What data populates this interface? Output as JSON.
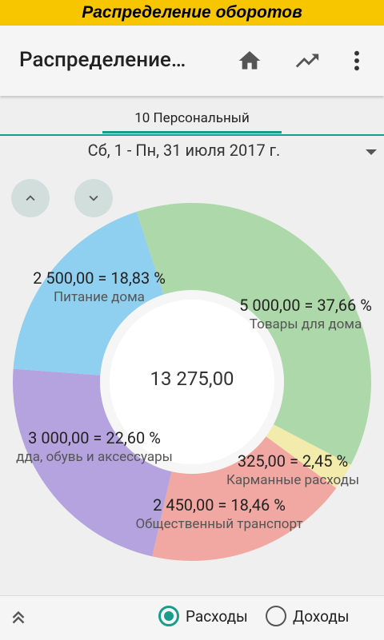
{
  "banner": {
    "text": "Распределение оборотов"
  },
  "appbar": {
    "title": "Распределение…",
    "icons": [
      "home-icon",
      "trending-icon",
      "more-vert-icon"
    ]
  },
  "tabs": [
    {
      "label": "10 Персональный",
      "active": true
    }
  ],
  "period": {
    "label": "Сб, 1 - Пн, 31 июля 2017 г."
  },
  "colors": {
    "accent": "#1a9c8a",
    "banner": "#f7c600",
    "food": "#8fcff0",
    "home_goods": "#add8a9",
    "pocket": "#f2ebab",
    "transport": "#f1a8a3",
    "clothes": "#b4a3de"
  },
  "chart_data": {
    "type": "pie",
    "total": "13 275,00",
    "slices": [
      {
        "name": "Товары для дома",
        "value": 5000.0,
        "label": "5 000,00 = 37,66 %",
        "color": "#add8a9"
      },
      {
        "name": "Карманные расходы",
        "value": 325.0,
        "label": "325,00 = 2,45 %",
        "color": "#f2ebab"
      },
      {
        "name": "Общественный транспорт",
        "value": 2450.0,
        "label": "2 450,00 = 18,46 %",
        "color": "#f1a8a3"
      },
      {
        "name": "дда, обувь и аксессуары",
        "value": 3000.0,
        "label": "3 000,00 = 22,60 %",
        "color": "#b4a3de"
      },
      {
        "name": "Питание дома",
        "value": 2500.0,
        "label": "2 500,00 = 18,83 %",
        "color": "#8fcff0"
      }
    ]
  },
  "bottom": {
    "expense_label": "Расходы",
    "income_label": "Доходы",
    "selected": "expense"
  }
}
